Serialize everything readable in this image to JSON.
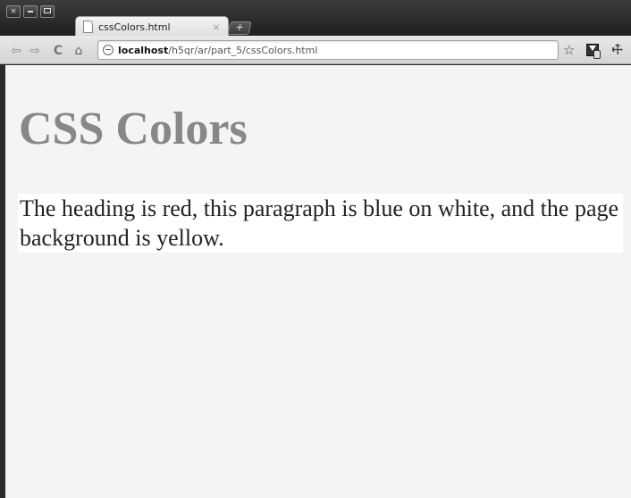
{
  "window": {
    "buttons": [
      "×",
      "–",
      "□"
    ]
  },
  "tab": {
    "title": "cssColors.html",
    "close": "×"
  },
  "newtab": {
    "label": "+"
  },
  "toolbar": {
    "back_icon": "⇦",
    "forward_icon": "⇨",
    "reload_icon": "C",
    "home_icon": "⌂",
    "star_icon": "☆",
    "wrench_icon": "🔧"
  },
  "address": {
    "host": "localhost",
    "path": "/h5qr/ar/part_5/cssColors.html"
  },
  "page": {
    "heading": "CSS Colors",
    "paragraph": "The heading is red, this paragraph is blue on white, and the page background is yellow."
  },
  "colors": {
    "page_background": "#f4f4f4",
    "heading": "#888888",
    "paragraph_text": "#222222",
    "paragraph_background": "#ffffff"
  }
}
